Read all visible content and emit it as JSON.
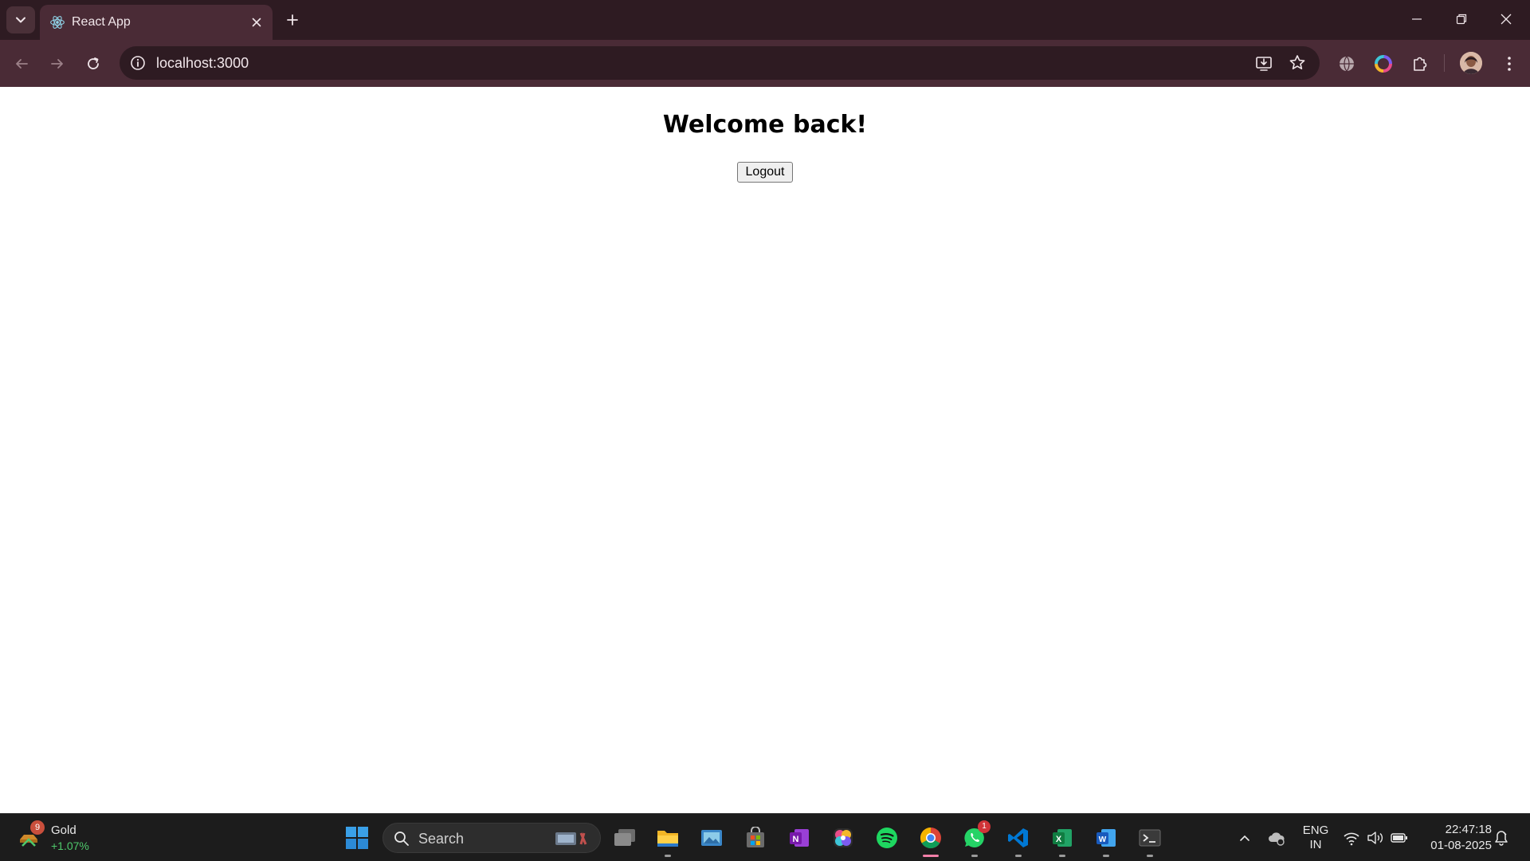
{
  "browser": {
    "tab": {
      "title": "React App",
      "favicon": "react-icon"
    },
    "address_bar": {
      "url": "localhost:3000",
      "site_info_icon": "info-icon"
    },
    "toolbar_icons": [
      "back-icon",
      "forward-icon",
      "reload-icon",
      "install-app-icon",
      "bookmark-star-icon",
      "globe-extension-icon",
      "color-extension-icon",
      "extensions-puzzle-icon",
      "profile-avatar",
      "menu-kebab-icon"
    ],
    "window_controls": [
      "minimize-icon",
      "restore-icon",
      "close-icon"
    ],
    "colors": {
      "tabstrip": "#2e1b22",
      "toolbar": "#4a2b36"
    }
  },
  "page": {
    "heading": "Welcome back!",
    "logout_label": "Logout"
  },
  "taskbar": {
    "widget": {
      "badge": "9",
      "title": "Gold",
      "change": "+1.07%"
    },
    "search": {
      "placeholder": "Search"
    },
    "apps": [
      {
        "name": "start",
        "icon": "windows-start-icon"
      },
      {
        "name": "task-view",
        "icon": "task-view-icon"
      },
      {
        "name": "file-explorer",
        "icon": "folder-icon"
      },
      {
        "name": "photos",
        "icon": "photos-icon"
      },
      {
        "name": "microsoft-store",
        "icon": "store-icon"
      },
      {
        "name": "onenote",
        "icon": "onenote-icon"
      },
      {
        "name": "copilot",
        "icon": "copilot-icon"
      },
      {
        "name": "spotify",
        "icon": "spotify-icon"
      },
      {
        "name": "chrome",
        "icon": "chrome-icon"
      },
      {
        "name": "whatsapp",
        "icon": "whatsapp-icon",
        "badge": "1"
      },
      {
        "name": "vscode",
        "icon": "vscode-icon"
      },
      {
        "name": "excel",
        "icon": "excel-icon"
      },
      {
        "name": "word",
        "icon": "word-icon"
      },
      {
        "name": "terminal",
        "icon": "terminal-icon"
      }
    ],
    "tray": {
      "language_top": "ENG",
      "language_bottom": "IN",
      "time": "22:47:18",
      "date": "01-08-2025"
    }
  }
}
